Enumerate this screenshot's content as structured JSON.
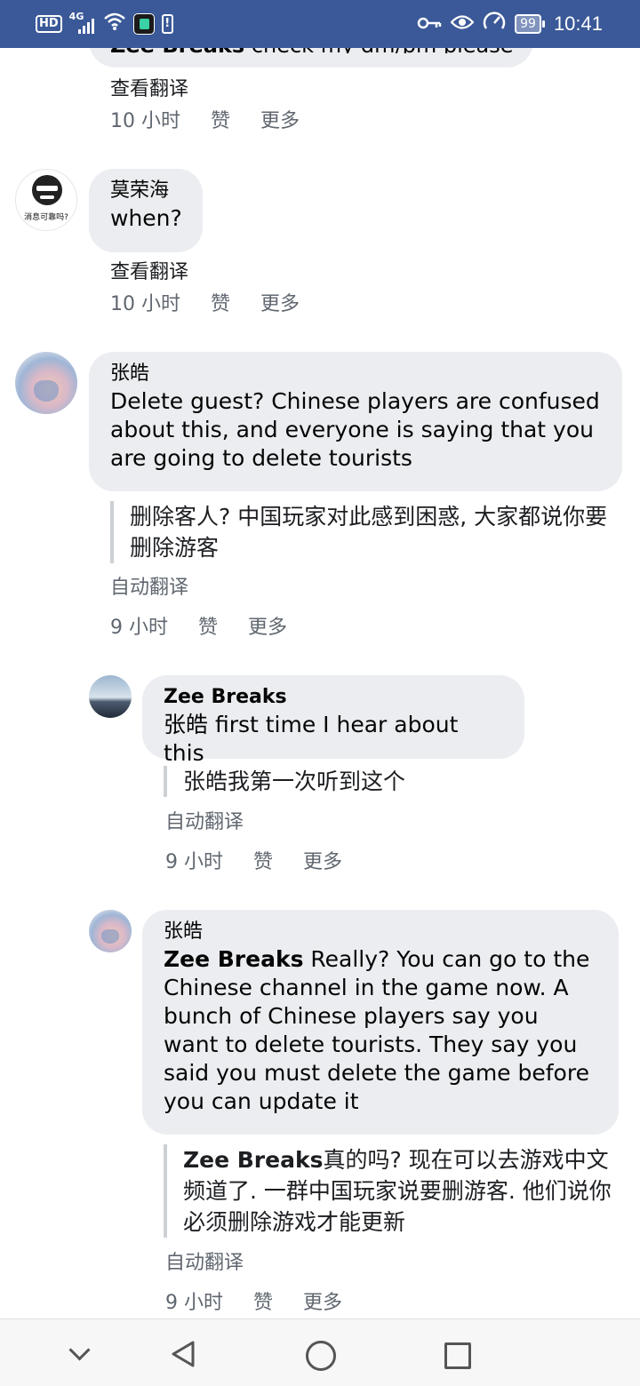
{
  "status_bar": {
    "hd": "HD",
    "network": "4G",
    "battery": "99",
    "time": "10:41"
  },
  "comments": [
    {
      "partial_text": "check my dm/pm please",
      "translate_link": "查看翻译",
      "time": "10 小时",
      "like": "赞",
      "more": "更多"
    },
    {
      "author": "莫荣海",
      "avatar_caption": "消息可靠吗?",
      "text": "when?",
      "translate_link": "查看翻译",
      "time": "10 小时",
      "like": "赞",
      "more": "更多"
    },
    {
      "author": "张皓",
      "text": "Delete guest? Chinese players are confused about this, and everyone is saying that you are going to delete tourists",
      "translation": "删除客人? 中国玩家对此感到困惑, 大家都说你要删除游客",
      "auto_translate": "自动翻译",
      "time": "9 小时",
      "like": "赞",
      "more": "更多"
    },
    {
      "author": "Zee Breaks",
      "text": "张皓 first time I hear about this",
      "translation": "张皓我第一次听到这个",
      "auto_translate": "自动翻译",
      "time": "9 小时",
      "like": "赞",
      "more": "更多"
    },
    {
      "author": "张皓",
      "mention": "Zee Breaks",
      "text": " Really? You can go to the Chinese channel in the game now. A bunch of Chinese players say you want to delete tourists. They say you said you must delete the game before you can update it",
      "translation_mention": "Zee Breaks",
      "translation": "真的吗? 现在可以去游戏中文频道了. 一群中国玩家说要删游客. 他们说你必须删除游戏才能更新",
      "auto_translate": "自动翻译",
      "time": "9 小时",
      "like": "赞",
      "more": "更多"
    }
  ],
  "nav": {
    "icons": [
      "chevron-down-icon",
      "back-icon",
      "home-icon",
      "recents-icon"
    ]
  },
  "colors": {
    "status_bar": "#3b5998",
    "bubble": "#ebedf0",
    "meta_text": "#606770"
  }
}
